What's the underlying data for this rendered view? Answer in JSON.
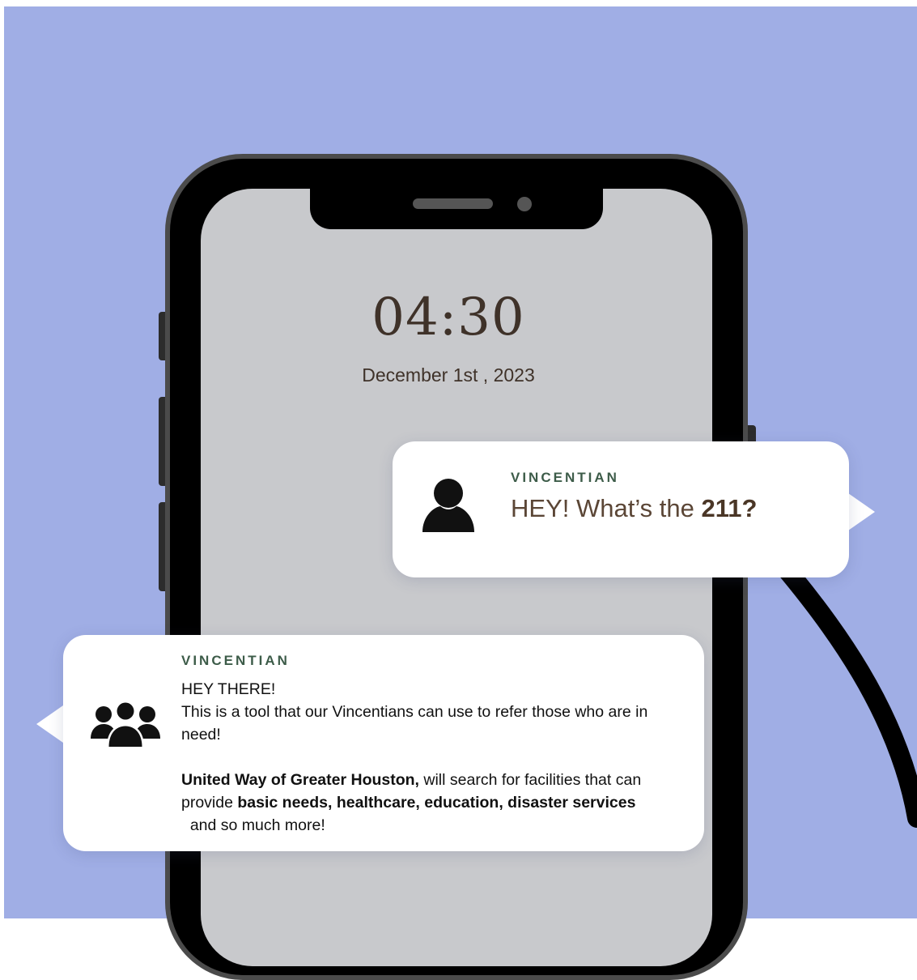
{
  "lock_screen": {
    "time": "04:30",
    "date": "December 1st , 2023"
  },
  "notifications": [
    {
      "sender": "VINCENTIAN",
      "icon": "person-icon",
      "message_plain": "HEY! What’s the ",
      "message_bold": "211?"
    },
    {
      "sender": "VINCENTIAN",
      "icon": "group-icon",
      "greeting": "HEY THERE!",
      "line1": "This is a tool that our Vincentians can use to refer those who are in need!",
      "org_name": "United Way of Greater Houston,",
      "text_after_org": " will search for facilities that can provide ",
      "services_bold": "basic needs, healthcare, education, disaster services",
      "closing": "  and so much more!"
    }
  ],
  "colors": {
    "background": "#a0aee5",
    "sender_label": "#3d5c49",
    "clock_text": "#3f3229"
  }
}
